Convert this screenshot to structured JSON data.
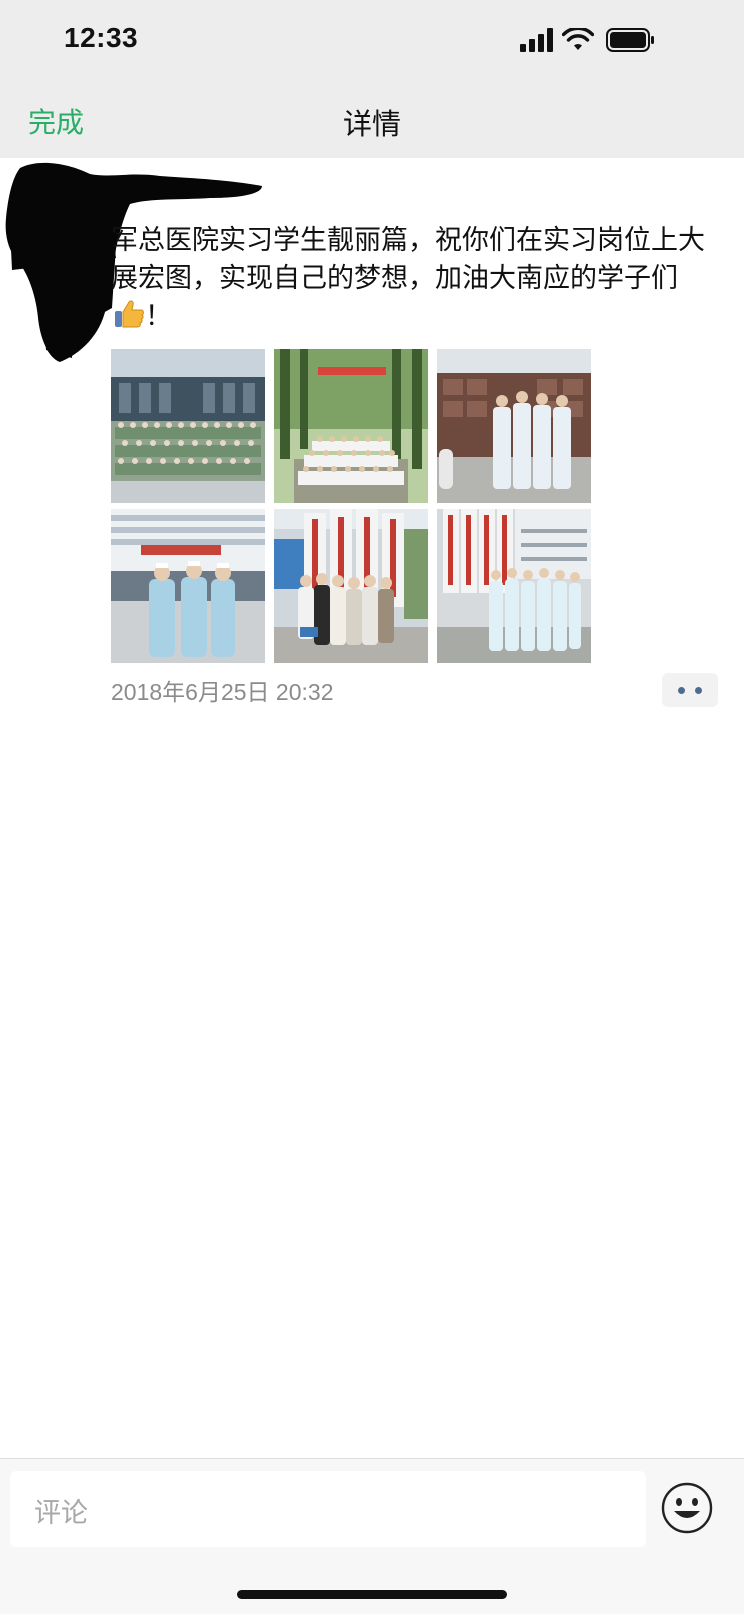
{
  "status_bar": {
    "time": "12:33",
    "icons": [
      "cellular-signal-icon",
      "wifi-icon",
      "battery-icon"
    ]
  },
  "nav": {
    "done_label": "完成",
    "title": "详情"
  },
  "post": {
    "text": "军总医院实习学生靓丽篇，祝你们在实习岗位上大展宏图，实现自己的梦想，加油大南应的学子们",
    "emoji": "thumbs-up-icon",
    "text_suffix": "！",
    "photos": [
      {
        "name": "group-photo-outside-hospital"
      },
      {
        "name": "group-photo-on-tree-lined-road"
      },
      {
        "name": "nurses-in-front-of-sign-wall"
      },
      {
        "name": "three-nurses-outside-building"
      },
      {
        "name": "group-in-front-of-name-boards"
      },
      {
        "name": "nurses-at-gate-with-plaques"
      }
    ],
    "timestamp": "2018年6月25日 20:32"
  },
  "comment": {
    "placeholder": "评论",
    "emoji_icon": "smiley-icon"
  },
  "colors": {
    "accent_green": "#2aae67",
    "link_blue": "#4e6b92",
    "nav_background": "#ededed"
  }
}
